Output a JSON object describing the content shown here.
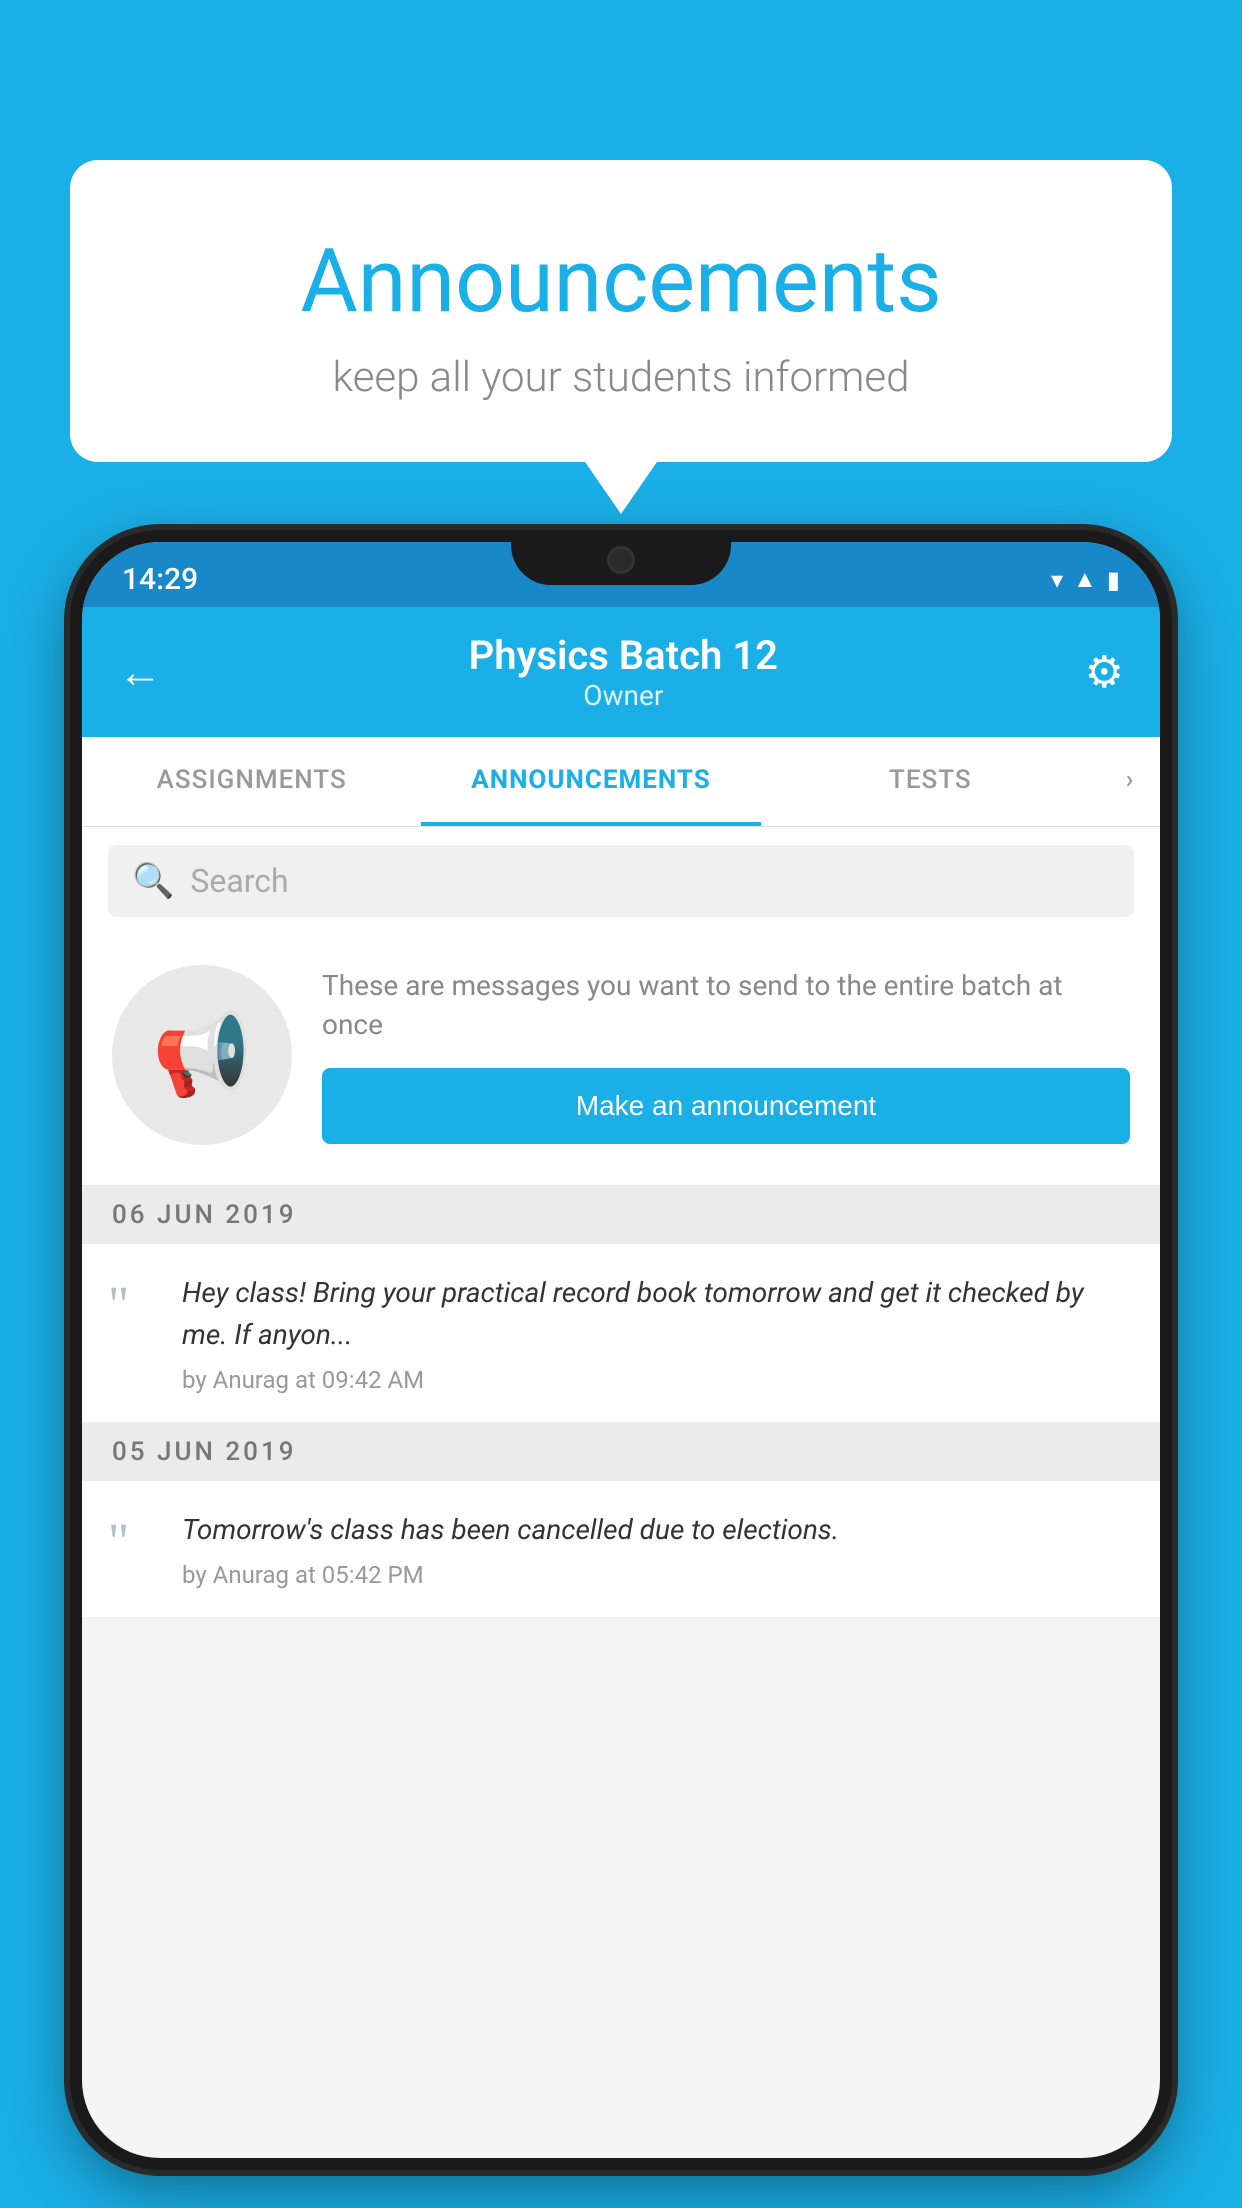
{
  "background_color": "#1AAFE6",
  "speech_bubble": {
    "title": "Announcements",
    "subtitle": "keep all your students informed"
  },
  "phone": {
    "status_bar": {
      "time": "14:29",
      "icons": [
        "wifi",
        "signal",
        "battery"
      ]
    },
    "header": {
      "title": "Physics Batch 12",
      "subtitle": "Owner",
      "back_label": "←",
      "gear_label": "⚙"
    },
    "tabs": [
      {
        "label": "ASSIGNMENTS",
        "active": false
      },
      {
        "label": "ANNOUNCEMENTS",
        "active": true
      },
      {
        "label": "TESTS",
        "active": false
      },
      {
        "label": "...",
        "active": false
      }
    ],
    "search": {
      "placeholder": "Search"
    },
    "promo": {
      "description": "These are messages you want to send to the entire batch at once",
      "button_label": "Make an announcement"
    },
    "announcements": [
      {
        "date": "06  JUN  2019",
        "text": "Hey class! Bring your practical record book tomorrow and get it checked by me. If anyon...",
        "meta": "by Anurag at 09:42 AM"
      },
      {
        "date": "05  JUN  2019",
        "text": "Tomorrow's class has been cancelled due to elections.",
        "meta": "by Anurag at 05:42 PM"
      }
    ]
  }
}
